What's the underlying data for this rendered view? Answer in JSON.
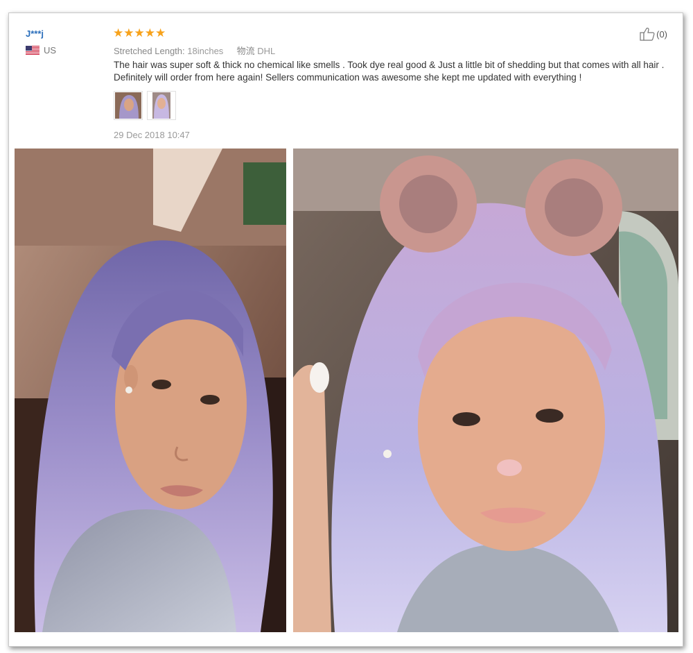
{
  "review": {
    "reviewer_name": "J***j",
    "country": "US",
    "rating": 5,
    "stars": [
      "★",
      "★",
      "★",
      "★",
      "★"
    ],
    "length_label": "Stretched Length:",
    "length_value": "18inches",
    "shipping_label": "物流",
    "shipping_value": "DHL",
    "text": "The hair was super soft & thick no chemical like smells . Took dye real good & Just a little bit of shedding but that comes with all hair . Definitely will order from here again! Sellers communication was awesome she kept me updated with everything !",
    "date": "29 Dec 2018 10:47",
    "helpful_count": "(0)",
    "thumbnails": [
      "photo-thumbnail-1",
      "photo-thumbnail-2"
    ]
  },
  "colors": {
    "name_link": "#2a6ebb",
    "star": "#f7a21b",
    "muted_text": "#999999",
    "hair_lavender": "#b7a6d6"
  },
  "icons": {
    "helpful": "thumbs-up-icon",
    "flag": "us-flag-icon"
  }
}
